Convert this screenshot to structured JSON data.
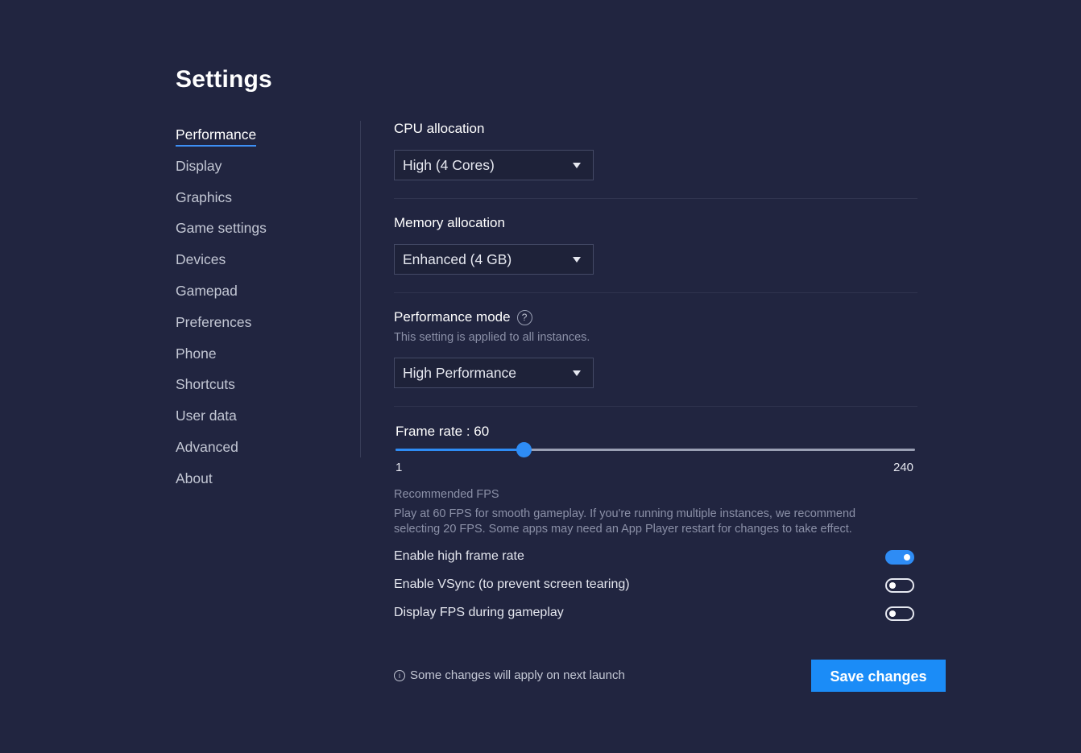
{
  "page": {
    "title": "Settings"
  },
  "sidebar": {
    "active_index": 0,
    "items": [
      {
        "label": "Performance"
      },
      {
        "label": "Display"
      },
      {
        "label": "Graphics"
      },
      {
        "label": "Game settings"
      },
      {
        "label": "Devices"
      },
      {
        "label": "Gamepad"
      },
      {
        "label": "Preferences"
      },
      {
        "label": "Phone"
      },
      {
        "label": "Shortcuts"
      },
      {
        "label": "User data"
      },
      {
        "label": "Advanced"
      },
      {
        "label": "About"
      }
    ]
  },
  "cpu": {
    "label": "CPU allocation",
    "value": "High (4 Cores)"
  },
  "memory": {
    "label": "Memory allocation",
    "value": "Enhanced (4 GB)"
  },
  "performance_mode": {
    "label": "Performance mode",
    "help_icon": "question-circle-icon",
    "hint": "This setting is applied to all instances.",
    "value": "High Performance"
  },
  "frame_rate": {
    "label": "Frame rate : 60",
    "value": 60,
    "min": 1,
    "max": 240,
    "min_label": "1",
    "max_label": "240",
    "recommended_title": "Recommended FPS",
    "recommended_line1": "Play at 60 FPS for smooth gameplay. If you're running multiple instances, we recommend",
    "recommended_line2": "selecting 20 FPS. Some apps may need an App Player restart for changes to take effect."
  },
  "toggles": [
    {
      "label": "Enable high frame rate",
      "on": true
    },
    {
      "label": "Enable VSync (to prevent screen tearing)",
      "on": false
    },
    {
      "label": "Display FPS during gameplay",
      "on": false
    }
  ],
  "footer": {
    "note": "Some changes will apply on next launch",
    "info_icon": "info-circle-icon",
    "save_label": "Save changes"
  },
  "colors": {
    "background": "#212540",
    "accent": "#1b8cf7"
  }
}
